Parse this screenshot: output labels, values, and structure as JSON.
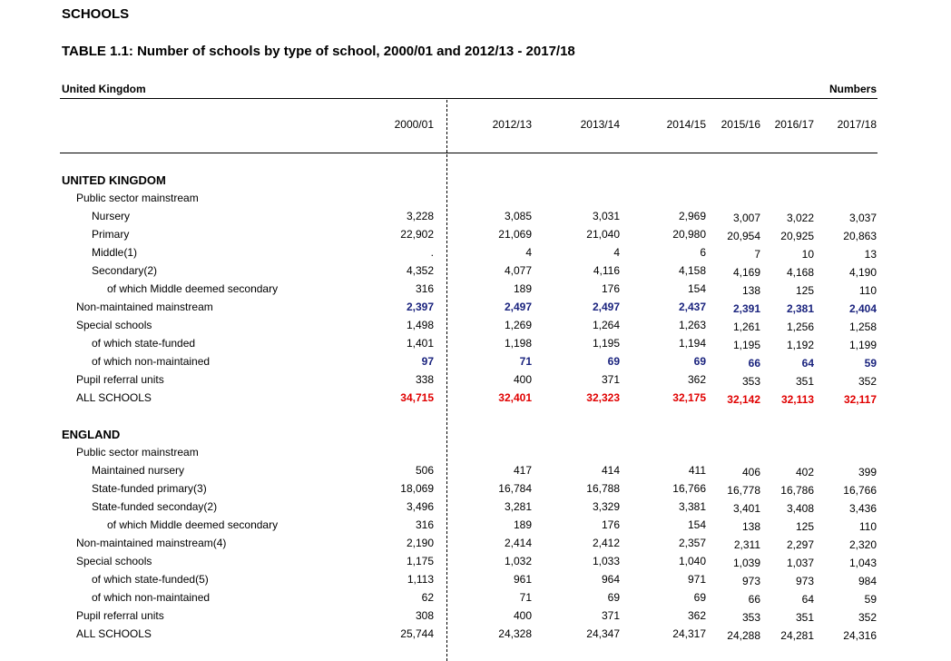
{
  "page": {
    "title": "SCHOOLS",
    "table_title": "TABLE 1.1:  Number of schools by type of school, 2000/01 and 2012/13 - 2017/18",
    "region": "United Kingdom",
    "units": "Numbers"
  },
  "columns": [
    "2000/01",
    "2012/13",
    "2013/14",
    "2014/15",
    "2015/16",
    "2016/17",
    "2017/18"
  ],
  "rows": [
    {
      "label": "UNITED KINGDOM",
      "indent": 0,
      "section": true,
      "values": []
    },
    {
      "label": "Public sector mainstream",
      "indent": 1,
      "values": []
    },
    {
      "label": "Nursery",
      "indent": 2,
      "values": [
        "3,228",
        "3,085",
        "3,031",
        "2,969",
        "3,007",
        "3,022",
        "3,037"
      ]
    },
    {
      "label": "Primary",
      "indent": 2,
      "values": [
        "22,902",
        "21,069",
        "21,040",
        "20,980",
        "20,954",
        "20,925",
        "20,863"
      ]
    },
    {
      "label": "Middle(1)",
      "indent": 2,
      "values": [
        ".",
        "4",
        "4",
        "6",
        "7",
        "10",
        "13"
      ]
    },
    {
      "label": "Secondary(2)",
      "indent": 2,
      "values": [
        "4,352",
        "4,077",
        "4,116",
        "4,158",
        "4,169",
        "4,168",
        "4,190"
      ]
    },
    {
      "label": "of which Middle deemed secondary",
      "indent": 3,
      "values": [
        "316",
        "189",
        "176",
        "154",
        "138",
        "125",
        "110"
      ]
    },
    {
      "label": "Non-maintained mainstream",
      "indent": 1,
      "style": "blue",
      "values": [
        "2,397",
        "2,497",
        "2,497",
        "2,437",
        "2,391",
        "2,381",
        "2,404"
      ]
    },
    {
      "label": "Special schools",
      "indent": 1,
      "values": [
        "1,498",
        "1,269",
        "1,264",
        "1,263",
        "1,261",
        "1,256",
        "1,258"
      ]
    },
    {
      "label": "of which state-funded",
      "indent": 2,
      "values": [
        "1,401",
        "1,198",
        "1,195",
        "1,194",
        "1,195",
        "1,192",
        "1,199"
      ]
    },
    {
      "label": "of which non-maintained",
      "indent": 2,
      "style": "blue",
      "values": [
        "97",
        "71",
        "69",
        "69",
        "66",
        "64",
        "59"
      ]
    },
    {
      "label": "Pupil referral units",
      "indent": 1,
      "values": [
        "338",
        "400",
        "371",
        "362",
        "353",
        "351",
        "352"
      ]
    },
    {
      "label": "ALL SCHOOLS",
      "indent": 1,
      "style": "red",
      "values": [
        "34,715",
        "32,401",
        "32,323",
        "32,175",
        "32,142",
        "32,113",
        "32,117"
      ]
    },
    {
      "label": "",
      "indent": 0,
      "spacer": true,
      "values": []
    },
    {
      "label": "ENGLAND",
      "indent": 0,
      "section": true,
      "values": []
    },
    {
      "label": "Public sector mainstream",
      "indent": 1,
      "values": []
    },
    {
      "label": "Maintained nursery",
      "indent": 2,
      "values": [
        "506",
        "417",
        "414",
        "411",
        "406",
        "402",
        "399"
      ]
    },
    {
      "label": "State-funded primary(3)",
      "indent": 2,
      "values": [
        "18,069",
        "16,784",
        "16,788",
        "16,766",
        "16,778",
        "16,786",
        "16,766"
      ]
    },
    {
      "label": "State-funded seconday(2)",
      "indent": 2,
      "values": [
        "3,496",
        "3,281",
        "3,329",
        "3,381",
        "3,401",
        "3,408",
        "3,436"
      ]
    },
    {
      "label": "of which Middle deemed secondary",
      "indent": 3,
      "values": [
        "316",
        "189",
        "176",
        "154",
        "138",
        "125",
        "110"
      ]
    },
    {
      "label": "Non-maintained mainstream(4)",
      "indent": 1,
      "values": [
        "2,190",
        "2,414",
        "2,412",
        "2,357",
        "2,311",
        "2,297",
        "2,320"
      ]
    },
    {
      "label": "Special schools",
      "indent": 1,
      "values": [
        "1,175",
        "1,032",
        "1,033",
        "1,040",
        "1,039",
        "1,037",
        "1,043"
      ]
    },
    {
      "label": "of which state-funded(5)",
      "indent": 2,
      "values": [
        "1,113",
        "961",
        "964",
        "971",
        "973",
        "973",
        "984"
      ]
    },
    {
      "label": "of which non-maintained",
      "indent": 2,
      "values": [
        "62",
        "71",
        "69",
        "69",
        "66",
        "64",
        "59"
      ]
    },
    {
      "label": "Pupil referral units",
      "indent": 1,
      "values": [
        "308",
        "400",
        "371",
        "362",
        "353",
        "351",
        "352"
      ]
    },
    {
      "label": "ALL SCHOOLS",
      "indent": 1,
      "values": [
        "25,744",
        "24,328",
        "24,347",
        "24,317",
        "24,288",
        "24,281",
        "24,316"
      ]
    }
  ],
  "colors": {
    "blue": "#1a237e",
    "red": "#e00000"
  }
}
